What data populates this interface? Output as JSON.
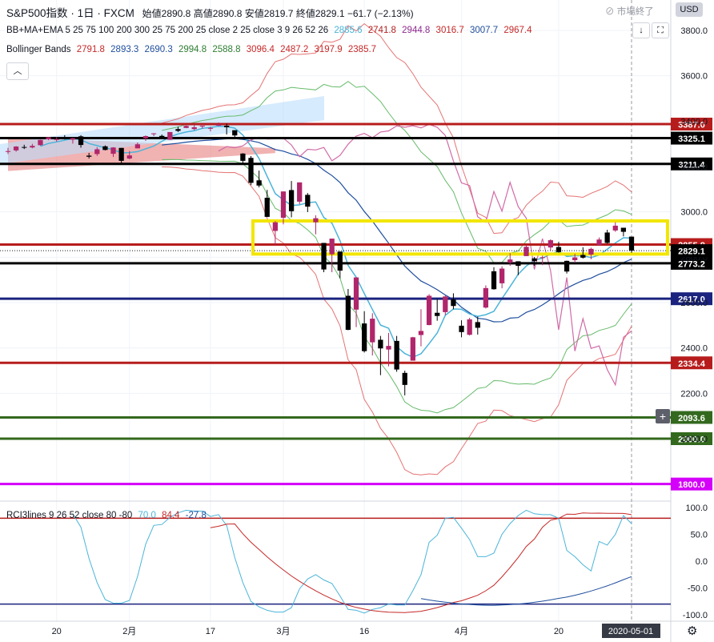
{
  "header": {
    "symbol": "S&P500指数",
    "interval": "1日",
    "source": "FXCM",
    "ohlc": [
      {
        "label": "始値",
        "value": "2890.8"
      },
      {
        "label": "高値",
        "value": "2890.8"
      },
      {
        "label": "安値",
        "value": "2819.7"
      },
      {
        "label": "終値",
        "value": "2829.1"
      }
    ],
    "change": "−61.7 (−2.13%)"
  },
  "indicators": {
    "bb_ma_ema": {
      "label": "BB+MA+EMA 5 25 75 100 200 300 25 75 200 25 close 2 25 close 3 9 26 52 26",
      "values": [
        {
          "v": "2885.6",
          "color": "#4bb4d9"
        },
        {
          "v": "2741.8",
          "color": "#b22222"
        },
        {
          "v": "2944.8",
          "color": "#8e2a8e"
        },
        {
          "v": "3016.7",
          "color": "#c62828"
        },
        {
          "v": "3007.7",
          "color": "#1f4e9e"
        },
        {
          "v": "2967.4",
          "color": "#c62828"
        }
      ]
    },
    "bollinger": {
      "label": "Bollinger Bands",
      "values": [
        {
          "v": "2791.8",
          "color": "#c62828"
        },
        {
          "v": "2893.3",
          "color": "#1f4e9e"
        },
        {
          "v": "2690.3",
          "color": "#1f4e9e"
        },
        {
          "v": "2994.8",
          "color": "#2e7d32"
        },
        {
          "v": "2588.8",
          "color": "#2e7d32"
        },
        {
          "v": "3096.4",
          "color": "#c62828"
        },
        {
          "v": "2487.2",
          "color": "#c62828"
        },
        {
          "v": "3197.9",
          "color": "#c62828"
        },
        {
          "v": "2385.7",
          "color": "#c62828"
        }
      ]
    },
    "rci": {
      "label": "RCI3lines 9 26 52 close 80 -80",
      "values": [
        {
          "v": "70.0",
          "color": "#4bb4d9"
        },
        {
          "v": "84.4",
          "color": "#c62828"
        },
        {
          "v": "-27.8",
          "color": "#1f4e9e"
        }
      ]
    }
  },
  "status": {
    "market": "市場終了",
    "currency": "USD",
    "collapse_icon": "chevron-up-icon",
    "settings_icon": "gear-icon"
  },
  "chart_data": {
    "type": "candlestick",
    "title": "S&P500指数 1日 FXCM",
    "ylim": [
      1700,
      3900
    ],
    "y_ticks": [
      2000,
      2200,
      2400,
      2600,
      2800,
      3000,
      3200,
      3400,
      3600,
      3800
    ],
    "y_tick_labels": [
      "2000.0",
      "2200.0",
      "2400.0",
      "2600.0",
      "2800.0",
      "3000.0",
      "3200.0",
      "3400.0",
      "3600.0",
      "3800.0"
    ],
    "x_tick_labels": [
      {
        "label": "20",
        "date": "2020-01-20"
      },
      {
        "label": "2月",
        "date": "2020-02-03"
      },
      {
        "label": "17",
        "date": "2020-02-17"
      },
      {
        "label": "3月",
        "date": "2020-03-02"
      },
      {
        "label": "16",
        "date": "2020-03-16"
      },
      {
        "label": "4月",
        "date": "2020-04-01"
      },
      {
        "label": "20",
        "date": "2020-04-20"
      }
    ],
    "current_date_label": "2020-05-01",
    "candles": [
      {
        "date": "2020-01-10",
        "o": 3265,
        "h": 3282,
        "l": 3255,
        "c": 3268
      },
      {
        "date": "2020-01-13",
        "o": 3271,
        "h": 3290,
        "l": 3265,
        "c": 3288
      },
      {
        "date": "2020-01-14",
        "o": 3286,
        "h": 3296,
        "l": 3277,
        "c": 3283
      },
      {
        "date": "2020-01-15",
        "o": 3284,
        "h": 3300,
        "l": 3280,
        "c": 3291
      },
      {
        "date": "2020-01-16",
        "o": 3294,
        "h": 3318,
        "l": 3292,
        "c": 3317
      },
      {
        "date": "2020-01-17",
        "o": 3320,
        "h": 3330,
        "l": 3316,
        "c": 3329
      },
      {
        "date": "2020-01-21",
        "o": 3320,
        "h": 3330,
        "l": 3310,
        "c": 3321
      },
      {
        "date": "2020-01-22",
        "o": 3330,
        "h": 3338,
        "l": 3319,
        "c": 3322
      },
      {
        "date": "2020-01-23",
        "o": 3318,
        "h": 3327,
        "l": 3301,
        "c": 3325
      },
      {
        "date": "2020-01-24",
        "o": 3333,
        "h": 3338,
        "l": 3283,
        "c": 3295
      },
      {
        "date": "2020-01-27",
        "o": 3248,
        "h": 3260,
        "l": 3235,
        "c": 3243
      },
      {
        "date": "2020-01-28",
        "o": 3255,
        "h": 3285,
        "l": 3247,
        "c": 3276
      },
      {
        "date": "2020-01-29",
        "o": 3289,
        "h": 3293,
        "l": 3271,
        "c": 3273
      },
      {
        "date": "2020-01-30",
        "o": 3256,
        "h": 3285,
        "l": 3242,
        "c": 3284
      },
      {
        "date": "2020-01-31",
        "o": 3282,
        "h": 3282,
        "l": 3214,
        "c": 3225
      },
      {
        "date": "2020-02-03",
        "o": 3235,
        "h": 3268,
        "l": 3232,
        "c": 3249
      },
      {
        "date": "2020-02-04",
        "o": 3280,
        "h": 3306,
        "l": 3280,
        "c": 3298
      },
      {
        "date": "2020-02-05",
        "o": 3324,
        "h": 3337,
        "l": 3313,
        "c": 3334
      },
      {
        "date": "2020-02-06",
        "o": 3344,
        "h": 3347,
        "l": 3334,
        "c": 3346
      },
      {
        "date": "2020-02-07",
        "o": 3335,
        "h": 3341,
        "l": 3323,
        "c": 3327
      },
      {
        "date": "2020-02-10",
        "o": 3318,
        "h": 3352,
        "l": 3317,
        "c": 3352
      },
      {
        "date": "2020-02-11",
        "o": 3365,
        "h": 3375,
        "l": 3352,
        "c": 3357
      },
      {
        "date": "2020-02-12",
        "o": 3370,
        "h": 3381,
        "l": 3369,
        "c": 3379
      },
      {
        "date": "2020-02-13",
        "o": 3365,
        "h": 3385,
        "l": 3360,
        "c": 3373
      },
      {
        "date": "2020-02-14",
        "o": 3378,
        "h": 3380,
        "l": 3367,
        "c": 3380
      },
      {
        "date": "2020-02-18",
        "o": 3369,
        "h": 3375,
        "l": 3355,
        "c": 3370
      },
      {
        "date": "2020-02-19",
        "o": 3380,
        "h": 3394,
        "l": 3378,
        "c": 3386
      },
      {
        "date": "2020-02-20",
        "o": 3380,
        "h": 3389,
        "l": 3341,
        "c": 3373
      },
      {
        "date": "2020-02-21",
        "o": 3360,
        "h": 3360,
        "l": 3328,
        "c": 3337
      },
      {
        "date": "2020-02-24",
        "o": 3257,
        "h": 3259,
        "l": 3214,
        "c": 3225
      },
      {
        "date": "2020-02-25",
        "o": 3238,
        "h": 3246,
        "l": 3118,
        "c": 3128
      },
      {
        "date": "2020-02-26",
        "o": 3139,
        "h": 3182,
        "l": 3108,
        "c": 3116
      },
      {
        "date": "2020-02-27",
        "o": 3062,
        "h": 3097,
        "l": 2977,
        "c": 2978
      },
      {
        "date": "2020-02-28",
        "o": 2916,
        "h": 2959,
        "l": 2855,
        "c": 2954
      },
      {
        "date": "2020-03-02",
        "o": 2974,
        "h": 3090,
        "l": 2945,
        "c": 3090
      },
      {
        "date": "2020-03-03",
        "o": 3096,
        "h": 3136,
        "l": 2976,
        "c": 3003
      },
      {
        "date": "2020-03-04",
        "o": 3045,
        "h": 3130,
        "l": 3034,
        "c": 3130
      },
      {
        "date": "2020-03-05",
        "o": 3075,
        "h": 3083,
        "l": 2999,
        "c": 3023
      },
      {
        "date": "2020-03-06",
        "o": 2954,
        "h": 2985,
        "l": 2901,
        "c": 2972
      },
      {
        "date": "2020-03-09",
        "o": 2863,
        "h": 2863,
        "l": 2734,
        "c": 2746
      },
      {
        "date": "2020-03-10",
        "o": 2813,
        "h": 2882,
        "l": 2734,
        "c": 2882
      },
      {
        "date": "2020-03-11",
        "o": 2825,
        "h": 2825,
        "l": 2707,
        "c": 2741
      },
      {
        "date": "2020-03-12",
        "o": 2630,
        "h": 2660,
        "l": 2478,
        "c": 2480
      },
      {
        "date": "2020-03-13",
        "o": 2569,
        "h": 2711,
        "l": 2492,
        "c": 2711
      },
      {
        "date": "2020-03-16",
        "o": 2508,
        "h": 2562,
        "l": 2380,
        "c": 2386
      },
      {
        "date": "2020-03-17",
        "o": 2425,
        "h": 2553,
        "l": 2367,
        "c": 2529
      },
      {
        "date": "2020-03-18",
        "o": 2436,
        "h": 2453,
        "l": 2280,
        "c": 2398
      },
      {
        "date": "2020-03-19",
        "o": 2393,
        "h": 2466,
        "l": 2319,
        "c": 2409
      },
      {
        "date": "2020-03-20",
        "o": 2431,
        "h": 2453,
        "l": 2295,
        "c": 2305
      },
      {
        "date": "2020-03-23",
        "o": 2290,
        "h": 2300,
        "l": 2191,
        "c": 2237
      },
      {
        "date": "2020-03-24",
        "o": 2344,
        "h": 2449,
        "l": 2344,
        "c": 2447
      },
      {
        "date": "2020-03-25",
        "o": 2457,
        "h": 2571,
        "l": 2407,
        "c": 2475
      },
      {
        "date": "2020-03-26",
        "o": 2501,
        "h": 2637,
        "l": 2500,
        "c": 2630
      },
      {
        "date": "2020-03-27",
        "o": 2555,
        "h": 2615,
        "l": 2520,
        "c": 2541
      },
      {
        "date": "2020-03-30",
        "o": 2558,
        "h": 2631,
        "l": 2545,
        "c": 2627
      },
      {
        "date": "2020-03-31",
        "o": 2614,
        "h": 2641,
        "l": 2571,
        "c": 2585
      },
      {
        "date": "2020-04-01",
        "o": 2498,
        "h": 2522,
        "l": 2447,
        "c": 2470
      },
      {
        "date": "2020-04-02",
        "o": 2458,
        "h": 2533,
        "l": 2455,
        "c": 2526
      },
      {
        "date": "2020-04-03",
        "o": 2514,
        "h": 2538,
        "l": 2459,
        "c": 2489
      },
      {
        "date": "2020-04-06",
        "o": 2578,
        "h": 2676,
        "l": 2574,
        "c": 2664
      },
      {
        "date": "2020-04-07",
        "o": 2738,
        "h": 2756,
        "l": 2657,
        "c": 2659
      },
      {
        "date": "2020-04-08",
        "o": 2685,
        "h": 2760,
        "l": 2663,
        "c": 2750
      },
      {
        "date": "2020-04-09",
        "o": 2776,
        "h": 2818,
        "l": 2762,
        "c": 2790
      },
      {
        "date": "2020-04-13",
        "o": 2782,
        "h": 2782,
        "l": 2721,
        "c": 2762
      },
      {
        "date": "2020-04-14",
        "o": 2805,
        "h": 2851,
        "l": 2805,
        "c": 2846
      },
      {
        "date": "2020-04-15",
        "o": 2795,
        "h": 2801,
        "l": 2762,
        "c": 2783
      },
      {
        "date": "2020-04-16",
        "o": 2799,
        "h": 2807,
        "l": 2765,
        "c": 2800
      },
      {
        "date": "2020-04-17",
        "o": 2843,
        "h": 2879,
        "l": 2831,
        "c": 2875
      },
      {
        "date": "2020-04-20",
        "o": 2845,
        "h": 2868,
        "l": 2820,
        "c": 2823
      },
      {
        "date": "2020-04-21",
        "o": 2784,
        "h": 2785,
        "l": 2728,
        "c": 2737
      },
      {
        "date": "2020-04-22",
        "o": 2787,
        "h": 2815,
        "l": 2775,
        "c": 2799
      },
      {
        "date": "2020-04-23",
        "o": 2810,
        "h": 2844,
        "l": 2794,
        "c": 2798
      },
      {
        "date": "2020-04-24",
        "o": 2812,
        "h": 2842,
        "l": 2791,
        "c": 2837
      },
      {
        "date": "2020-04-27",
        "o": 2854,
        "h": 2887,
        "l": 2852,
        "c": 2878
      },
      {
        "date": "2020-04-28",
        "o": 2909,
        "h": 2921,
        "l": 2860,
        "c": 2863
      },
      {
        "date": "2020-04-29",
        "o": 2918,
        "h": 2954,
        "l": 2912,
        "c": 2939
      },
      {
        "date": "2020-04-30",
        "o": 2930,
        "h": 2930,
        "l": 2892,
        "c": 2912
      },
      {
        "date": "2020-05-01",
        "o": 2890.8,
        "h": 2890.8,
        "l": 2819.7,
        "c": 2829.1
      }
    ],
    "horizontal_levels": [
      {
        "value": 3387.0,
        "label": "3387.0",
        "color": "#b71c1c"
      },
      {
        "value": 3325.1,
        "label": "3325.1",
        "color": "#000000"
      },
      {
        "value": 3211.4,
        "label": "3211.4",
        "color": "#000000"
      },
      {
        "value": 2855.8,
        "label": "2855.8",
        "color": "#b71c1c"
      },
      {
        "value": 2773.2,
        "label": "2773.2",
        "color": "#000000"
      },
      {
        "value": 2617.0,
        "label": "2617.0",
        "color": "#1a237e"
      },
      {
        "value": 2334.4,
        "label": "2334.4",
        "color": "#b71c1c"
      },
      {
        "value": 2093.6,
        "label": "2093.6",
        "color": "#33691e"
      },
      {
        "value": 2000.0,
        "label": "2000.0",
        "color": "#33691e"
      },
      {
        "value": 1800.0,
        "label": "1800.0",
        "color": "#d500f9"
      }
    ],
    "last_price": {
      "value": 2829.1,
      "label": "2829.1"
    },
    "highlight_zone": {
      "from": 2814,
      "to": 2960,
      "color": "#f2e600"
    },
    "rci_panel": {
      "ylim": [
        -105,
        105
      ],
      "y_ticks": [
        100,
        50,
        0,
        -50,
        -100
      ],
      "y_tick_labels": [
        "100.0",
        "50.0",
        "0.0",
        "-50.0",
        "-100.0"
      ],
      "levels": [
        80,
        -80
      ],
      "series": [
        {
          "name": "9",
          "color": "#4bb4d9",
          "last": 70.0
        },
        {
          "name": "26",
          "color": "#c62828",
          "last": 84.4
        },
        {
          "name": "52",
          "color": "#1f4e9e",
          "last": -27.8
        }
      ]
    }
  }
}
